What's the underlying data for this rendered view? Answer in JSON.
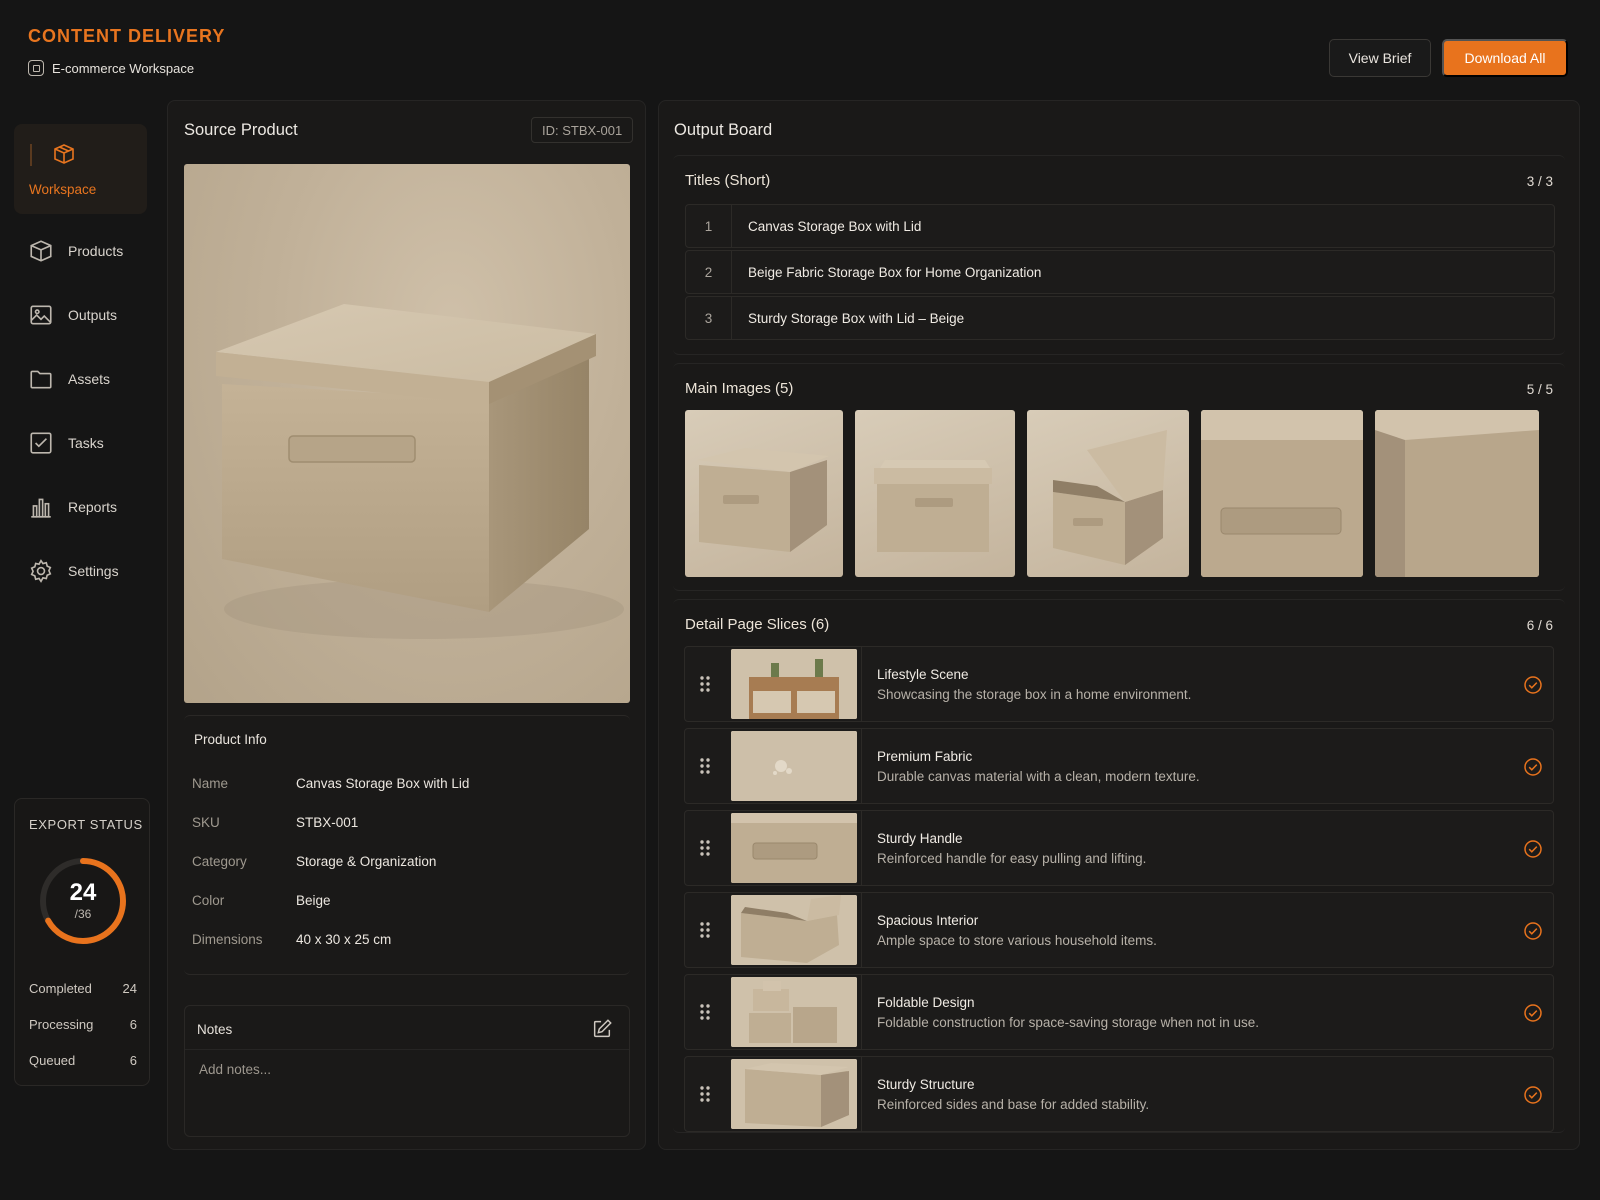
{
  "header": {
    "app_title": "CONTENT DELIVERY",
    "workspace": "E-commerce Workspace",
    "view_brief": "View Brief",
    "download_all": "Download All"
  },
  "sidebar": {
    "items": [
      {
        "label": "Workspace",
        "icon": "box-icon",
        "active": true
      },
      {
        "label": "Products",
        "icon": "cube-icon"
      },
      {
        "label": "Outputs",
        "icon": "image-icon"
      },
      {
        "label": "Assets",
        "icon": "folder-icon"
      },
      {
        "label": "Tasks",
        "icon": "checkbox-icon"
      },
      {
        "label": "Reports",
        "icon": "bar-chart-icon"
      },
      {
        "label": "Settings",
        "icon": "gear-icon"
      }
    ],
    "export_status": {
      "title": "EXPORT STATUS",
      "done": "24",
      "total": "/36",
      "progress": 0.667,
      "stats": [
        {
          "label": "Completed",
          "value": "24"
        },
        {
          "label": "Processing",
          "value": "6"
        },
        {
          "label": "Queued",
          "value": "6"
        }
      ]
    }
  },
  "source": {
    "title": "Source Product",
    "id_badge": "ID: STBX-001",
    "info_title": "Product Info",
    "info": [
      {
        "key": "Name",
        "value": "Canvas Storage Box with Lid"
      },
      {
        "key": "SKU",
        "value": "STBX-001"
      },
      {
        "key": "Category",
        "value": "Storage & Organization"
      },
      {
        "key": "Color",
        "value": "Beige"
      },
      {
        "key": "Dimensions",
        "value": "40 x 30 x 25 cm"
      }
    ],
    "notes_title": "Notes",
    "notes_placeholder": "Add notes..."
  },
  "output": {
    "title": "Output Board",
    "titles_section": {
      "title": "Titles (Short)",
      "count": "3 / 3",
      "items": [
        {
          "num": "1",
          "text": "Canvas Storage Box with Lid"
        },
        {
          "num": "2",
          "text": "Beige Fabric Storage Box for Home Organization"
        },
        {
          "num": "3",
          "text": "Sturdy Storage Box with Lid – Beige"
        }
      ]
    },
    "images_section": {
      "title": "Main Images (5)",
      "count": "5 / 5"
    },
    "slices_section": {
      "title": "Detail Page Slices (6)",
      "count": "6 / 6",
      "items": [
        {
          "title": "Lifestyle Scene",
          "desc": "Showcasing the storage box in a home environment."
        },
        {
          "title": "Premium Fabric",
          "desc": "Durable canvas material with a clean, modern texture."
        },
        {
          "title": "Sturdy Handle",
          "desc": "Reinforced handle for easy pulling and lifting."
        },
        {
          "title": "Spacious Interior",
          "desc": "Ample space to store various household items."
        },
        {
          "title": "Foldable Design",
          "desc": "Foldable construction for space-saving storage when not in use."
        },
        {
          "title": "Sturdy Structure",
          "desc": "Reinforced sides and base for added stability."
        }
      ]
    }
  },
  "colors": {
    "accent": "#e8731d",
    "background": "#151515",
    "panel": "#1a1918",
    "product_beige": "#c8b9a2"
  }
}
